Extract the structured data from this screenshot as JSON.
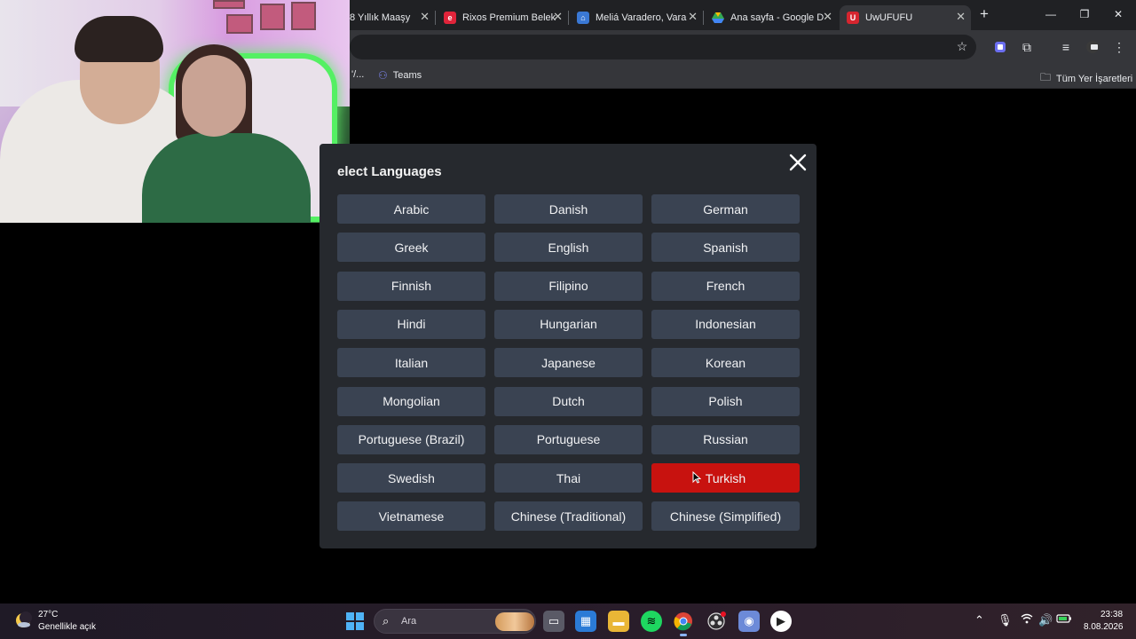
{
  "browser": {
    "tabs": [
      {
        "title": "8 Yıllık Maaşy",
        "favicon": "generic-page-icon",
        "color": "#35363a"
      },
      {
        "title": "Rixos Premium Belek",
        "favicon": "rixos-icon",
        "color": "#e0243a"
      },
      {
        "title": "Meliá Varadero, Vara",
        "favicon": "melia-icon",
        "color": "#3a78d4"
      },
      {
        "title": "Ana sayfa - Google D",
        "favicon": "google-drive-icon",
        "color": "#34a853"
      },
      {
        "title": "UwUFUFU",
        "favicon": "uwufufu-icon",
        "color": "#d6252f"
      }
    ],
    "active_tab_index": 4,
    "bookmarks": [
      {
        "label": "'/..."
      },
      {
        "label": "Teams"
      }
    ],
    "all_bookmarks_label": "Tüm Yer İşaretleri"
  },
  "modal": {
    "title": "elect Languages",
    "languages": [
      "Arabic",
      "Danish",
      "German",
      "Greek",
      "English",
      "Spanish",
      "Finnish",
      "Filipino",
      "French",
      "Hindi",
      "Hungarian",
      "Indonesian",
      "Italian",
      "Japanese",
      "Korean",
      "Mongolian",
      "Dutch",
      "Polish",
      "Portuguese (Brazil)",
      "Portuguese",
      "Russian",
      "Swedish",
      "Thai",
      "Turkish",
      "Vietnamese",
      "Chinese (Traditional)",
      "Chinese (Simplified)"
    ],
    "selected": "Turkish",
    "selected_color": "#c8120f",
    "button_color": "#3a4352"
  },
  "taskbar": {
    "weather_temp": "27°C",
    "weather_desc": "Genellikle açık",
    "search_placeholder": "Ara",
    "time": "23:38",
    "date": "8.08.2026"
  }
}
